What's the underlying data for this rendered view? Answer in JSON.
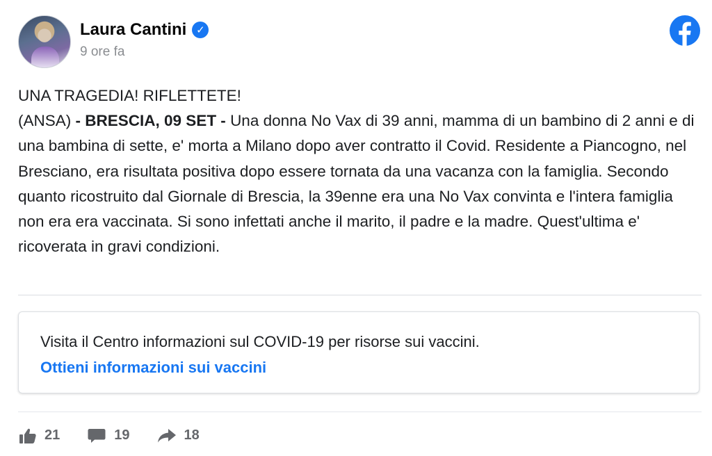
{
  "author": {
    "name": "Laura Cantini",
    "verified_glyph": "✓",
    "timestamp": "9 ore fa"
  },
  "brand": {
    "logo": "facebook-icon",
    "color": "#1877f2"
  },
  "post": {
    "headline": "UNA TRAGEDIA! RIFLETTETE!",
    "source_prefix": "(ANSA)",
    "dateline": " - BRESCIA, 09 SET - ",
    "body": "Una donna No Vax di 39 anni, mamma di un bambino di 2 anni e di una bambina di sette, e' morta a Milano dopo aver contratto il Covid. Residente a Piancogno, nel Bresciano, era risultata positiva dopo essere tornata da una vacanza con la famiglia. Secondo quanto ricostruito dal Giornale di Brescia, la 39enne era una No Vax convinta e l'intera famiglia non era era vaccinata. Si sono infettati anche il marito, il padre e la madre. Quest'ultima e' ricoverata in gravi condizioni."
  },
  "covid_info": {
    "text": "Visita il Centro informazioni sul COVID-19 per risorse sui vaccini.",
    "link": "Ottieni informazioni sui vaccini"
  },
  "stats": {
    "likes": "21",
    "comments": "19",
    "shares": "18",
    "icons": [
      "like-icon",
      "comment-icon",
      "share-icon"
    ],
    "color": "#65676b"
  }
}
